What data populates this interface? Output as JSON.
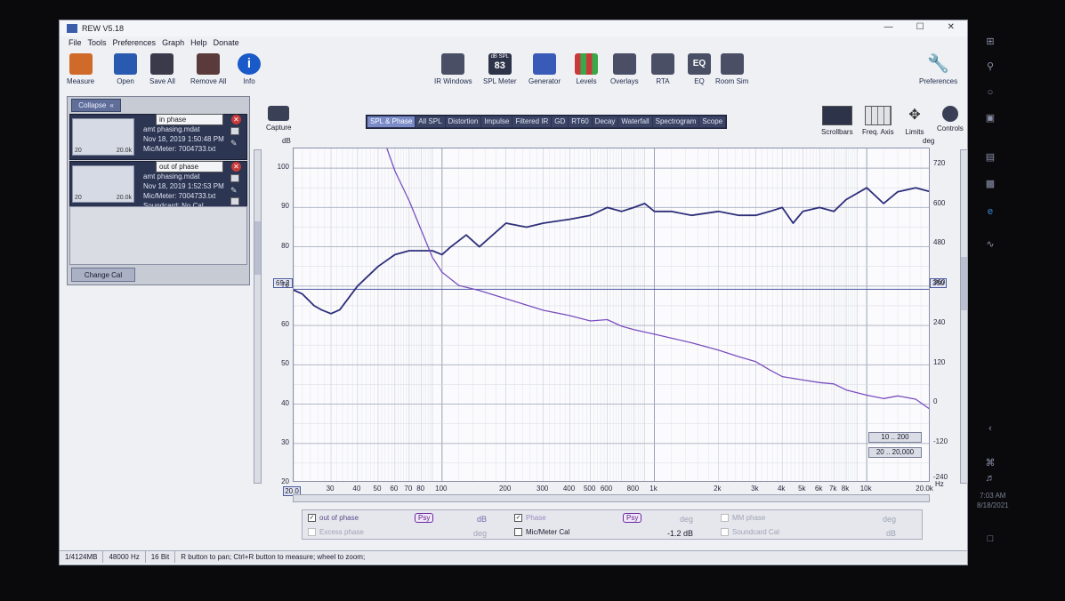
{
  "window": {
    "title": "REW V5.18"
  },
  "menu": [
    "File",
    "Tools",
    "Preferences",
    "Graph",
    "Help",
    "Donate"
  ],
  "toolbar_left": [
    {
      "label": "Measure",
      "icon": "measure-icon",
      "color": "#d06a2a"
    },
    {
      "label": "Open",
      "icon": "folder-icon",
      "color": "#2a5ab0"
    },
    {
      "label": "Save All",
      "icon": "save-icon",
      "color": "#3a3a4a"
    },
    {
      "label": "Remove All",
      "icon": "remove-icon",
      "color": "#5a3a3a"
    },
    {
      "label": "Info",
      "icon": "info-icon",
      "color": "#1a5ac8"
    }
  ],
  "toolbar_center": [
    {
      "label": "IR Windows",
      "icon": "ir-windows-icon"
    },
    {
      "label": "SPL Meter",
      "icon": "spl-meter-icon",
      "value": "83",
      "badge": "dB SPL"
    },
    {
      "label": "Generator",
      "icon": "generator-icon"
    },
    {
      "label": "Levels",
      "icon": "levels-icon"
    },
    {
      "label": "Overlays",
      "icon": "overlays-icon"
    },
    {
      "label": "RTA",
      "icon": "rta-icon"
    },
    {
      "label": "EQ",
      "icon": "eq-icon",
      "text": "EQ"
    },
    {
      "label": "Room Sim",
      "icon": "room-sim-icon"
    }
  ],
  "toolbar_right": {
    "label": "Preferences",
    "icon": "wrench-icon"
  },
  "panel": {
    "collapse_label": "Collapse",
    "change_cal_label": "Change Cal",
    "measurements": [
      {
        "name": "in phase",
        "file": "amt phasing.mdat",
        "date": "Nov 18, 2019 1:50:48 PM",
        "mic": "Mic/Meter: 7004733.txt",
        "soundcard": "",
        "thumb_left": "20",
        "thumb_right": "20.0k"
      },
      {
        "name": "out of phase",
        "file": "amt phasing.mdat",
        "date": "Nov 18, 2019 1:52:53 PM",
        "mic": "Mic/Meter: 7004733.txt",
        "soundcard": "Soundcard: No Cal",
        "thumb_left": "20",
        "thumb_right": "20.0k"
      }
    ]
  },
  "capture_label": "Capture",
  "tabs": [
    "SPL & Phase",
    "All SPL",
    "Distortion",
    "Impulse",
    "Filtered IR",
    "GD",
    "RT60",
    "Decay",
    "Waterfall",
    "Spectrogram",
    "Scope"
  ],
  "active_tab": "SPL & Phase",
  "right_tools": [
    {
      "label": "Scrollbars",
      "icon": "scrollbars-icon"
    },
    {
      "label": "Freq. Axis",
      "icon": "freq-axis-icon"
    },
    {
      "label": "Limits",
      "icon": "limits-icon"
    },
    {
      "label": "Controls",
      "icon": "controls-icon"
    }
  ],
  "axis": {
    "left_unit": "dB",
    "right_unit": "deg",
    "x_unit": "Hz",
    "x_start_label": "20.0",
    "y_left_ticks": [
      "100",
      "90",
      "80",
      "70",
      "60",
      "50",
      "40",
      "30",
      "20"
    ],
    "y_right_ticks": [
      "720",
      "600",
      "480",
      "360",
      "240",
      "120",
      "0",
      "-120",
      "-240"
    ],
    "x_ticks": [
      "30",
      "40",
      "50",
      "60",
      "70",
      "80",
      "100",
      "200",
      "300",
      "400",
      "500",
      "600",
      "800",
      "1k",
      "2k",
      "3k",
      "4k",
      "5k",
      "6k",
      "7k",
      "8k",
      "10k",
      "20.0k"
    ],
    "cursor_left": "69.2",
    "cursor_right": "350"
  },
  "range_buttons": [
    "10 .. 200",
    "20 .. 20,000"
  ],
  "chart_data": {
    "type": "line",
    "x_scale": "log",
    "xlim": [
      20,
      20000
    ],
    "ylim": [
      20,
      105
    ],
    "y2lim": [
      -240,
      768
    ],
    "series": [
      {
        "name": "out of phase",
        "color": "#2e2f7a",
        "axis": "left",
        "x": [
          20,
          22,
          25,
          27,
          30,
          33,
          40,
          50,
          60,
          70,
          80,
          90,
          100,
          110,
          130,
          150,
          200,
          250,
          300,
          400,
          500,
          600,
          700,
          800,
          900,
          1000,
          1200,
          1500,
          2000,
          2500,
          3000,
          3500,
          4000,
          4500,
          5000,
          6000,
          7000,
          8000,
          10000,
          12000,
          14000,
          17000,
          20000
        ],
        "y": [
          69,
          68,
          65,
          64,
          63,
          64,
          70,
          75,
          78,
          79,
          79,
          79,
          78,
          80,
          83,
          80,
          86,
          85,
          86,
          87,
          88,
          90,
          89,
          90,
          91,
          89,
          89,
          88,
          89,
          88,
          88,
          89,
          90,
          86,
          89,
          90,
          89,
          92,
          95,
          91,
          94,
          95,
          94
        ]
      },
      {
        "name": "Phase",
        "color": "#7a4fbf",
        "axis": "right",
        "x": [
          55,
          60,
          70,
          80,
          90,
          100,
          120,
          150,
          200,
          250,
          300,
          400,
          500,
          600,
          700,
          800,
          1000,
          1500,
          2000,
          2500,
          3000,
          3500,
          4000,
          5000,
          6000,
          7000,
          8000,
          10000,
          12000,
          14000,
          17000,
          20000
        ],
        "y": [
          768,
          700,
          610,
          520,
          440,
          395,
          355,
          340,
          315,
          296,
          280,
          264,
          248,
          252,
          232,
          222,
          208,
          182,
          160,
          140,
          125,
          100,
          80,
          70,
          62,
          58,
          40,
          24,
          14,
          22,
          12,
          -20
        ]
      }
    ]
  },
  "legend": {
    "spl": {
      "label": "out of phase",
      "psy": "Psy",
      "unit": "dB"
    },
    "phase": {
      "label": "Phase",
      "psy": "Psy",
      "unit": "deg"
    },
    "mm_phase": {
      "label": "MM phase",
      "unit": "deg"
    },
    "excess": {
      "label": "Excess phase",
      "unit": "deg"
    },
    "cal": {
      "label": "Mic/Meter Cal",
      "value": "-1.2 dB"
    },
    "soundcard": {
      "label": "Soundcard Cal",
      "unit": "dB"
    }
  },
  "status": [
    "1/4124MB",
    "48000 Hz",
    "16 Bit",
    "R button to pan; Ctrl+R button to measure; wheel to zoom;"
  ],
  "clock": {
    "time": "7:03 AM",
    "date": "8/18/2021"
  }
}
